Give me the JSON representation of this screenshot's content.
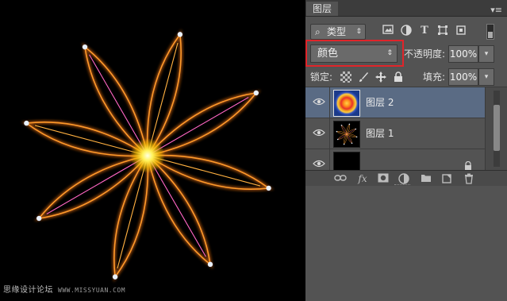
{
  "watermark": {
    "text": "思缘设计论坛",
    "url": "WWW.MISSYUAN.COM"
  },
  "panel": {
    "tab_label": "图层",
    "filter": {
      "kind_label": "类型",
      "search_glyph": "⌕",
      "icons": [
        "image-filter-icon",
        "adjustment-filter-icon",
        "text-filter-icon",
        "shape-filter-icon",
        "smart-object-filter-icon"
      ]
    },
    "blend_mode": "颜色",
    "opacity_label": "不透明度:",
    "opacity_value": "100%",
    "lock_label": "锁定:",
    "fill_label": "填充:",
    "fill_value": "100%",
    "layers": [
      {
        "name": "图层 2",
        "selected": true,
        "thumb": "radial"
      },
      {
        "name": "图层 1",
        "selected": false,
        "thumb": "flower"
      },
      {
        "name": "",
        "selected": false,
        "thumb": "black"
      }
    ],
    "colors": {
      "highlight": "#e0242a",
      "selection": "#5a6b84"
    }
  }
}
